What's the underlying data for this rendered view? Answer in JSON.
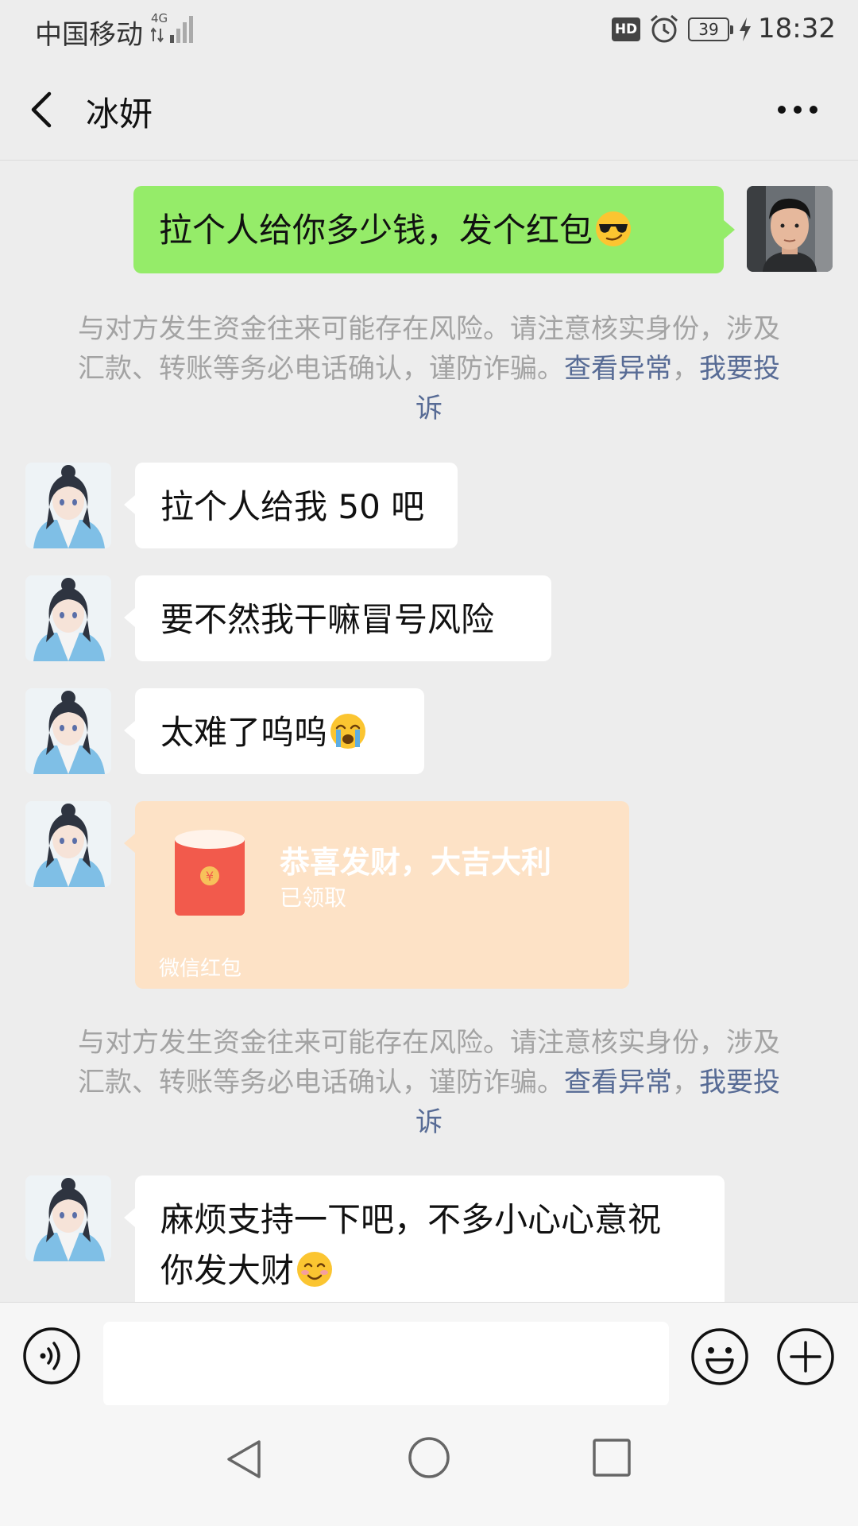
{
  "status_bar": {
    "carrier": "中国移动",
    "network": "4G",
    "hd": "HD",
    "battery": "39",
    "time": "18:32"
  },
  "header": {
    "title": "冰妍"
  },
  "messages": [
    {
      "side": "right",
      "text": "拉个人给你多少钱，发个红包",
      "emoji": "sunglasses-smirk-emoji"
    },
    {
      "side": "left",
      "text": "拉个人给我 50 吧"
    },
    {
      "side": "left",
      "text": "要不然我干嘛冒号风险"
    },
    {
      "side": "left",
      "text": "太难了呜呜",
      "emoji": "crying-emoji"
    },
    {
      "side": "left",
      "text_line1": "麻烦支持一下吧，不多小心心意祝",
      "text_line2": "你发大财",
      "emoji": "smiling-blush-emoji"
    }
  ],
  "system_notice": {
    "text": "与对方发生资金往来可能存在风险。请注意核实身份，涉及汇款、转账等务必电话确认，谨防诈骗。",
    "link_check": "查看异常",
    "separator": "，",
    "link_report": "我要投诉"
  },
  "red_packet": {
    "title": "恭喜发财，大吉大利",
    "status": "已领取",
    "footer": "微信红包",
    "symbol": "¥"
  },
  "input": {
    "placeholder": ""
  },
  "colors": {
    "background": "#ededed",
    "self_bubble": "#95ec69",
    "other_bubble": "#ffffff",
    "link": "#576b95",
    "notice_text": "#a3a3a3",
    "red_packet_bg": "#fde2c6",
    "red_packet_envelope": "#f25a4c"
  }
}
